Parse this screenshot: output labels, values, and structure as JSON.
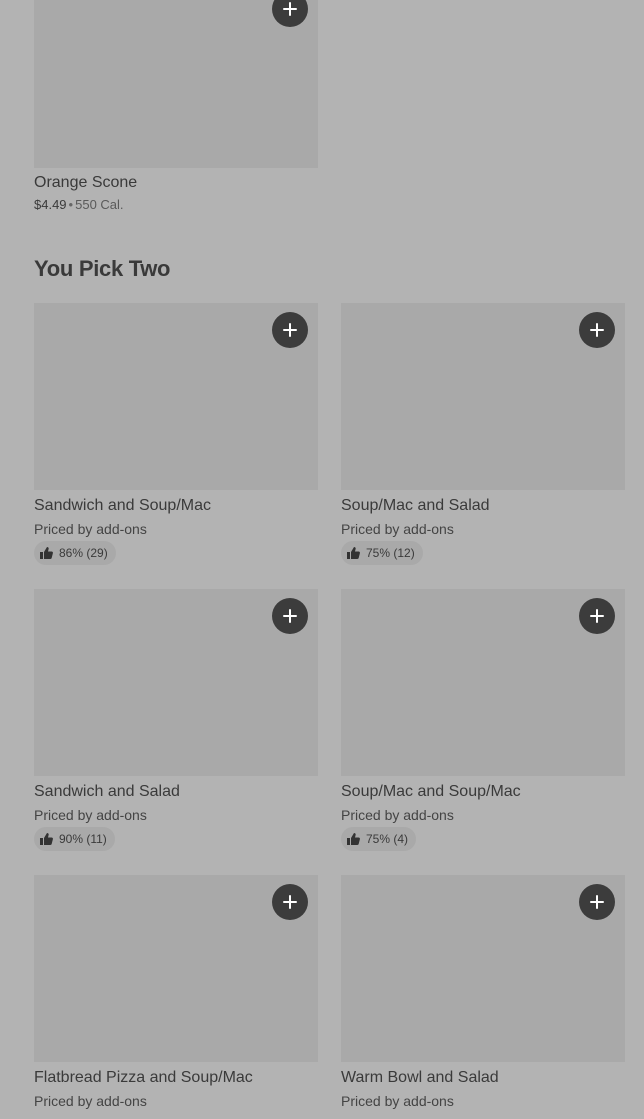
{
  "featured_item": {
    "name": "Orange Scone",
    "price": "$4.49",
    "separator": "•",
    "calories": "550 Cal."
  },
  "section": {
    "title": "You Pick Two"
  },
  "items": [
    {
      "name": "Sandwich and Soup/Mac",
      "price": "Priced by add-ons",
      "rating": "86% (29)"
    },
    {
      "name": "Soup/Mac and Salad",
      "price": "Priced by add-ons",
      "rating": "75% (12)"
    },
    {
      "name": "Sandwich and Salad",
      "price": "Priced by add-ons",
      "rating": "90% (11)"
    },
    {
      "name": "Soup/Mac and Soup/Mac",
      "price": "Priced by add-ons",
      "rating": "75% (4)"
    },
    {
      "name": "Flatbread Pizza and Soup/Mac",
      "price": "Priced by add-ons"
    },
    {
      "name": "Warm Bowl and Salad",
      "price": "Priced by add-ons"
    }
  ],
  "icons": {
    "add": "plus-icon",
    "rating": "thumbs-up-icon"
  }
}
